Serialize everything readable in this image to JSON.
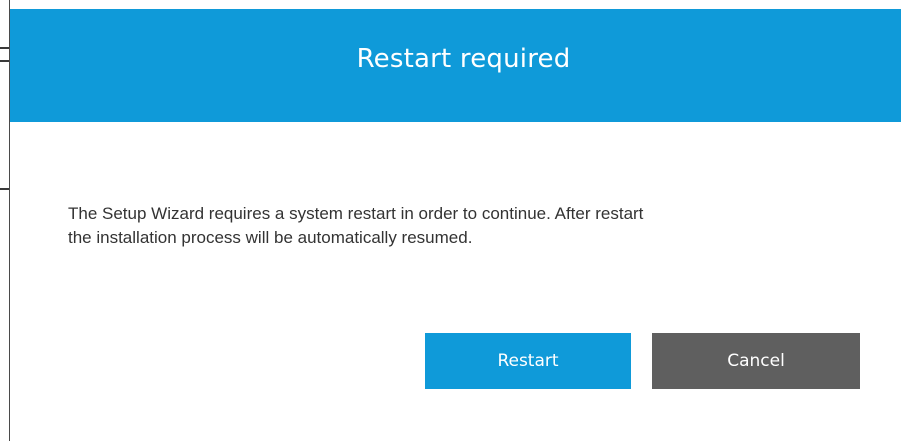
{
  "dialog": {
    "title": "Restart required",
    "message_line1": "The Setup Wizard requires a system restart in order to continue. After restart",
    "message_line2": "the installation process will be automatically resumed.",
    "buttons": {
      "restart_label": "Restart",
      "cancel_label": "Cancel"
    }
  },
  "colors": {
    "accent": "#0f9ad9",
    "secondary_button": "#5f5f5f",
    "text": "#333333"
  }
}
